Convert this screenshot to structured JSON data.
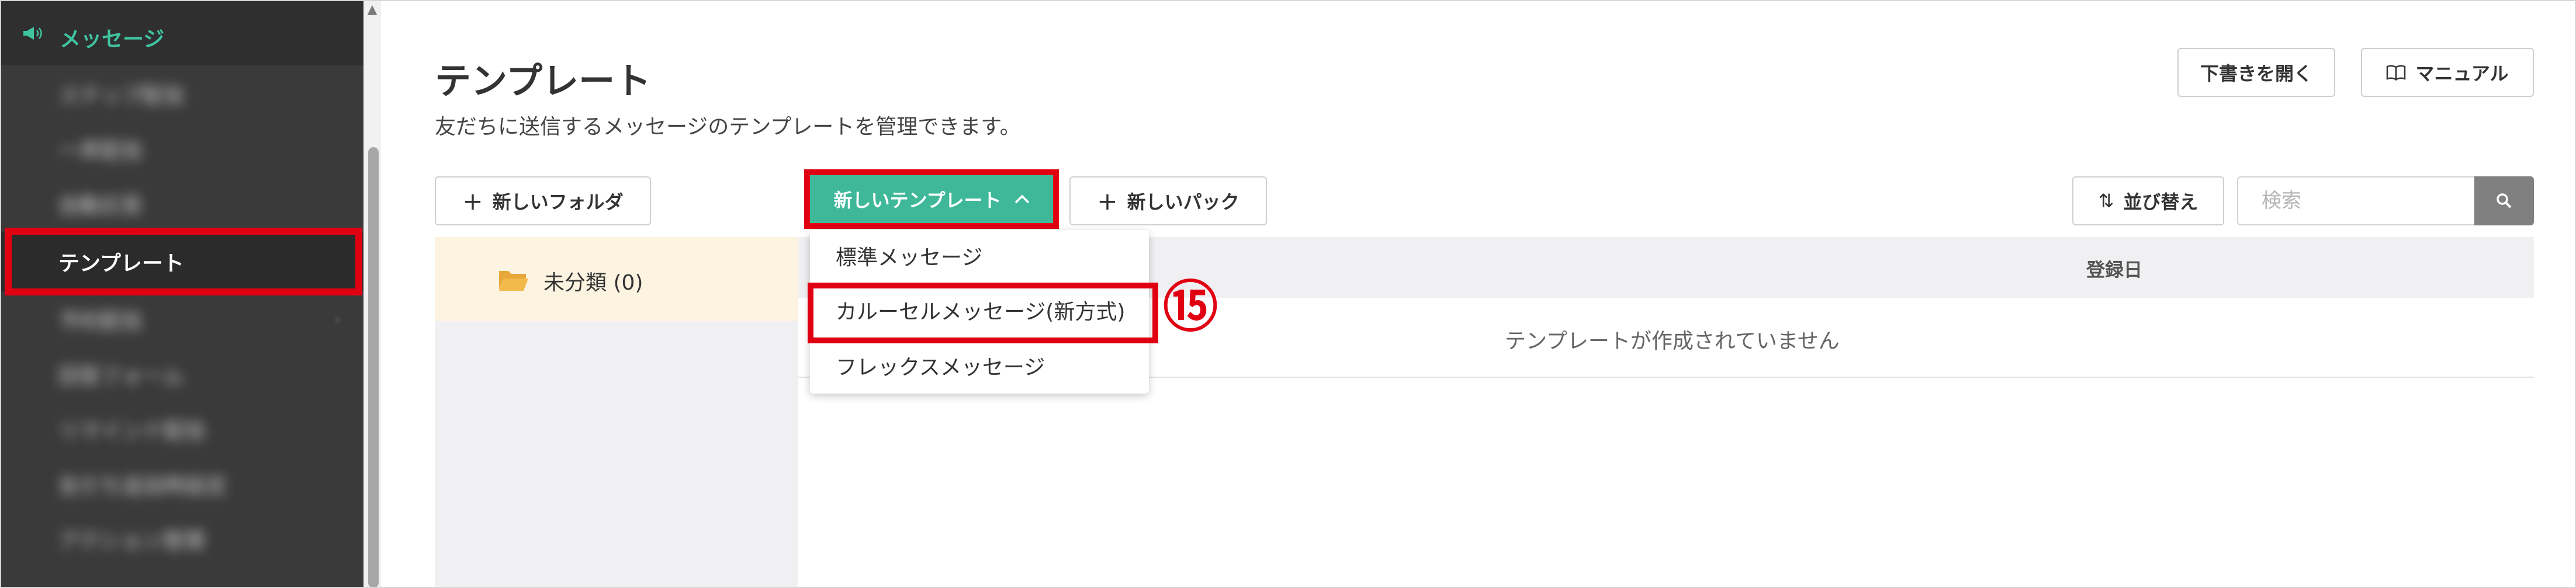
{
  "sidebar": {
    "header_label": "メッセージ",
    "items": [
      {
        "label": "ステップ配信",
        "blurred": true
      },
      {
        "label": "一斉配信",
        "blurred": true
      },
      {
        "label": "自動応答",
        "blurred": true
      },
      {
        "label": "テンプレート",
        "blurred": false,
        "active": true
      },
      {
        "label": "予約配信",
        "blurred": true
      },
      {
        "label": "回答フォーム",
        "blurred": true
      },
      {
        "label": "リマインド配信",
        "blurred": true
      },
      {
        "label": "友だち追加時設定",
        "blurred": true
      },
      {
        "label": "アクション管理",
        "blurred": true
      }
    ]
  },
  "header": {
    "title": "テンプレート",
    "subtitle": "友だちに送信するメッセージのテンプレートを管理できます。",
    "open_draft_label": "下書きを開く",
    "manual_label": "マニュアル"
  },
  "toolbar": {
    "new_folder_label": "新しいフォルダ",
    "new_template_label": "新しいテンプレート",
    "new_pack_label": "新しいパック",
    "sort_label": "並び替え",
    "search_placeholder": "検索"
  },
  "dropdown": {
    "items": [
      "標準メッセージ",
      "カルーセルメッセージ(新方式)",
      "フレックスメッセージ"
    ]
  },
  "annotation": {
    "step": "⑮"
  },
  "folders": [
    {
      "label": "未分類 (0)"
    }
  ],
  "table": {
    "date_column": "登録日",
    "empty_message": "テンプレートが作成されていません"
  },
  "colors": {
    "accent": "#3fb89a",
    "highlight": "#e00012",
    "sidebar_bg": "#3a3a3a",
    "folder_bg": "#fdf3e1"
  }
}
